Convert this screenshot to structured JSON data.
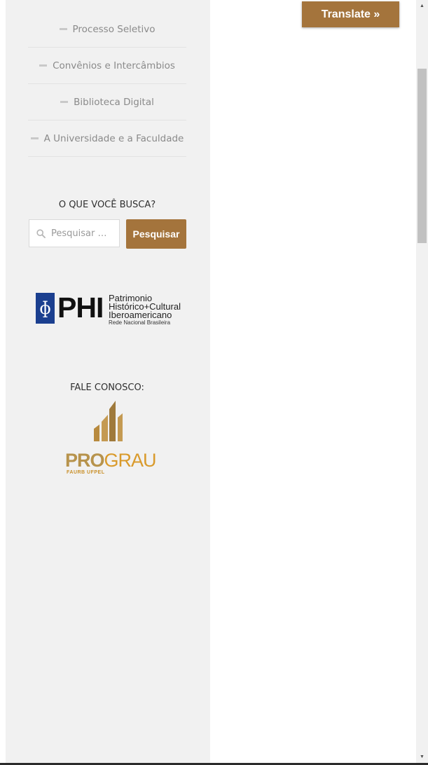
{
  "sidebar": {
    "menu": [
      {
        "label": "Processo Seletivo"
      },
      {
        "label": "Convênios e Intercâmbios"
      },
      {
        "label": "Biblioteca Digital"
      },
      {
        "label": "A Universidade e a Faculdade"
      }
    ],
    "search": {
      "title": "O QUE VOCÊ BUSCA?",
      "placeholder": "Pesquisar …",
      "button_label": "Pesquisar"
    },
    "phi_logo": {
      "symbol": "ɸ",
      "word": "PHI",
      "line1": "Patrimonio",
      "line2": "Histórico+Cultural",
      "line3": "Iberoamericano",
      "line4": "Rede Nacional Brasileira"
    },
    "contact": {
      "title": "FALE CONOSCO:",
      "logo_pro": "PRO",
      "logo_grau": "GRAU",
      "logo_sub": "FAURB UFPEL"
    }
  },
  "translate": {
    "label": "Translate »"
  },
  "colors": {
    "accent": "#a4743c",
    "sidebar_bg": "#f1f1f1",
    "phi_blue": "#1b3f8f",
    "prograu_gold": "#d99a2b"
  },
  "icons": {
    "search": "search-icon",
    "scroll_up": "scroll-up-arrow-icon",
    "scroll_down": "scroll-down-arrow-icon"
  }
}
